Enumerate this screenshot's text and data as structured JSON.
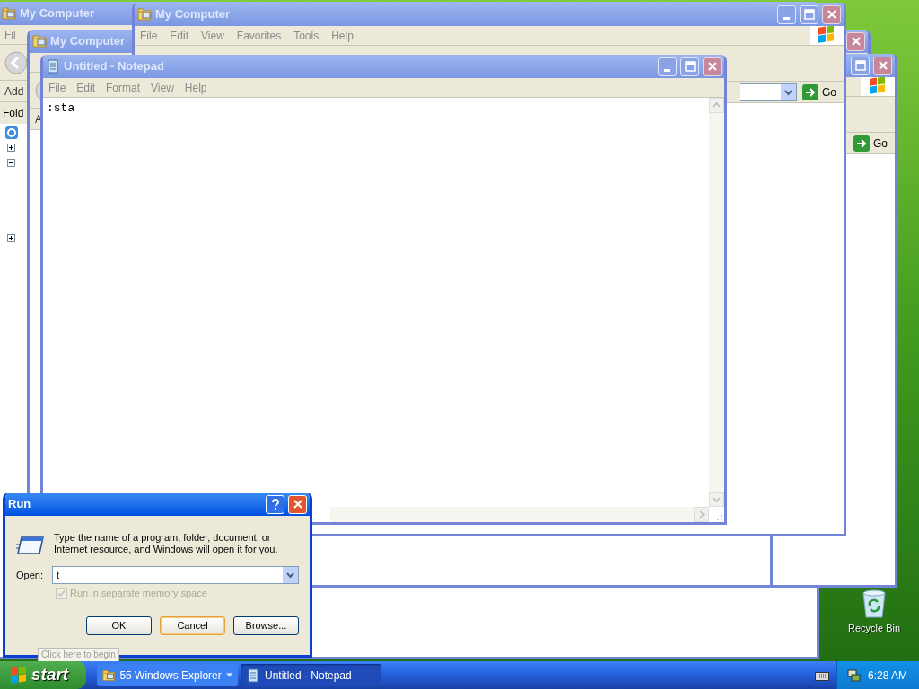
{
  "windows": [
    {
      "kind": "explorer",
      "title": "My Computer",
      "menu": [
        "Fil"
      ],
      "address_label": "Add",
      "folders_label": "Fold",
      "tree": true
    },
    {
      "kind": "explorer",
      "title": "My Computer",
      "address_label": "A"
    },
    {
      "kind": "explorer",
      "logo": true,
      "go_label": "Go"
    },
    {
      "kind": "explorer",
      "title": "My Computer",
      "menu": [
        "File",
        "Edit",
        "View",
        "Favorites",
        "Tools",
        "Help"
      ],
      "logo": true,
      "go_label": "Go"
    },
    {
      "kind": "notepad",
      "title": "Untitled - Notepad",
      "menu": [
        "File",
        "Edit",
        "Format",
        "View",
        "Help"
      ],
      "text": ":sta"
    },
    {
      "kind": "run",
      "title": "Run",
      "active": true,
      "description": "Type the name of a program, folder, document, or Internet resource, and Windows will open it for you.",
      "open_label": "Open:",
      "open_value": "t",
      "checkbox": {
        "label": "Run in separate memory space",
        "checked": true,
        "disabled": true
      },
      "buttons": [
        {
          "label": "OK",
          "focused": false
        },
        {
          "label": "Cancel",
          "focused": true
        },
        {
          "label": "Browse...",
          "focused": false
        }
      ]
    }
  ],
  "tooltip": "Click here to begin",
  "desktop_icons": [
    {
      "label": "Recycle Bin"
    }
  ],
  "taskbar": {
    "start": "start",
    "tasks": [
      {
        "label": "55 Windows Explorer",
        "group": true,
        "selected": false
      },
      {
        "label": "Untitled - Notepad",
        "group": false,
        "selected": true
      }
    ],
    "clock": "6:28 AM"
  }
}
